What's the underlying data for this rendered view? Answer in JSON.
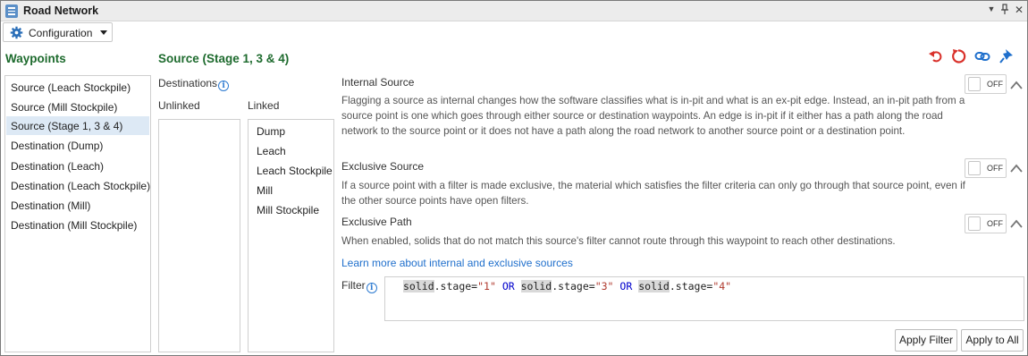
{
  "window": {
    "title": "Road Network"
  },
  "toolbar": {
    "config_label": "Configuration"
  },
  "waypoints": {
    "heading": "Waypoints",
    "items": [
      "Source (Leach Stockpile)",
      "Source (Mill Stockpile)",
      "Source (Stage 1, 3 & 4)",
      "Destination (Dump)",
      "Destination (Leach)",
      "Destination (Leach Stockpile)",
      "Destination (Mill)",
      "Destination (Mill Stockpile)"
    ],
    "selected": "Source (Stage 1, 3 & 4)"
  },
  "source": {
    "heading": "Source (Stage 1, 3 & 4)",
    "destinations_label": "Destinations",
    "unlinked_label": "Unlinked",
    "linked_label": "Linked",
    "unlinked_items": [],
    "linked_items": [
      "Dump",
      "Leach",
      "Leach Stockpile",
      "Mill",
      "Mill Stockpile"
    ]
  },
  "options": {
    "internal": {
      "title": "Internal Source",
      "toggle": "OFF",
      "description": "Flagging a source as internal changes how the software classifies what is in-pit and what is an ex-pit edge. Instead, an in-pit path from a source point is one which goes through either source or destination waypoints. An edge is in-pit if it either has a path along the road network to the source point or it does not have a path along the road network to another source point or a destination point."
    },
    "exclusive": {
      "title": "Exclusive Source",
      "toggle": "OFF",
      "description": "If a source point with a filter is made exclusive, the material which satisfies the filter criteria can only go through that source point, even if the other source points have open filters."
    },
    "path": {
      "title": "Exclusive Path",
      "toggle": "OFF",
      "description": "When enabled, solids that do not match this source's filter cannot route through this waypoint to reach other destinations."
    }
  },
  "learn_more": "Learn more about internal and exclusive sources",
  "filter": {
    "label": "Filter",
    "tokens": {
      "id1": "solid",
      "p1": ".stage=",
      "s1": "\"1\"",
      "kw1": "OR",
      "id2": "solid",
      "p2": ".stage=",
      "s2": "\"3\"",
      "kw2": "OR",
      "id3": "solid",
      "p3": ".stage=",
      "s3": "\"4\""
    }
  },
  "buttons": {
    "apply_filter": "Apply Filter",
    "apply_all": "Apply to All"
  },
  "colors": {
    "heading": "#1e6b2e",
    "link": "#1f6fcc",
    "selection": "#dde9f5",
    "undo_red": "#d9312b",
    "tool_blue": "#1f6fcc"
  },
  "icons": [
    "menu-icon",
    "gear-icon",
    "undo-icon",
    "reset-icon",
    "link-icon",
    "pin-icon",
    "info-icon",
    "chevron-up-icon"
  ]
}
